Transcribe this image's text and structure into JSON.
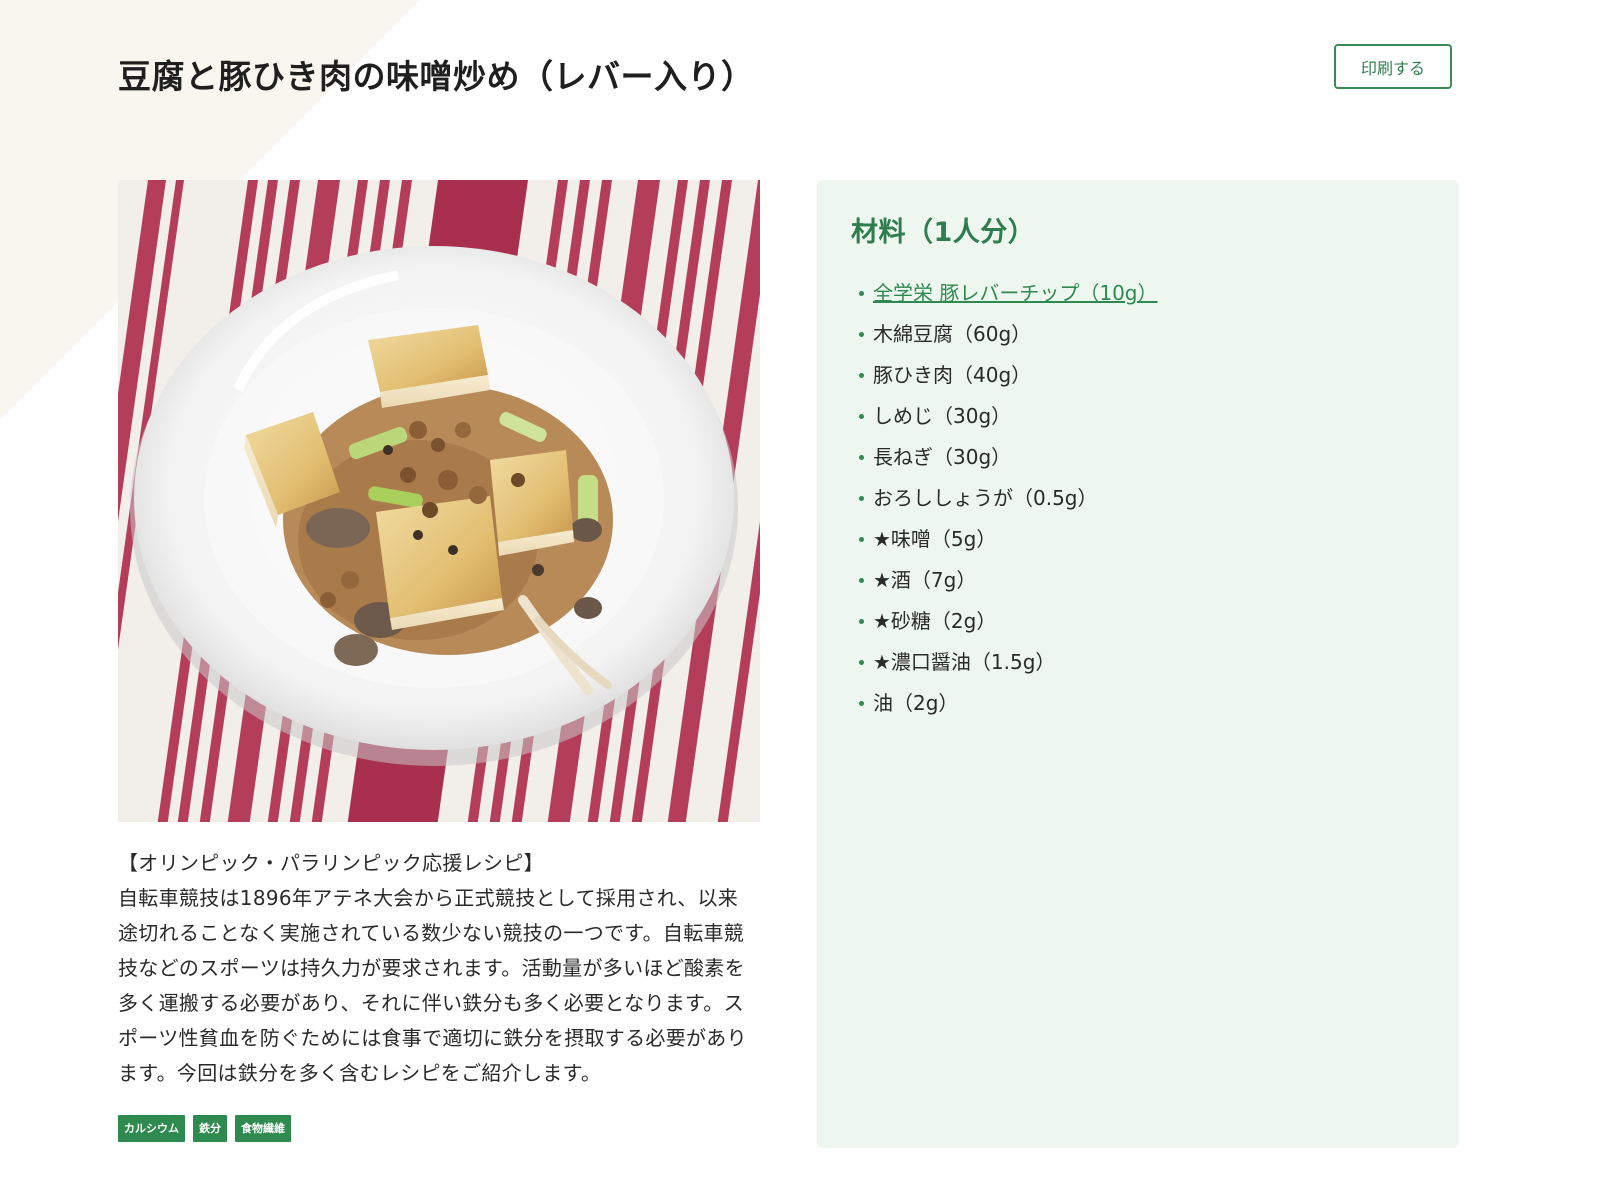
{
  "recipe": {
    "title": "豆腐と豚ひき肉の味噌炒め（レバー入り）",
    "print_label": "印刷する"
  },
  "description": {
    "heading": "【オリンピック・パラリンピック応援レシピ】",
    "body": "自転車競技は1896年アテネ大会から正式競技として採用され、以来途切れることなく実施されている数少ない競技の一つです。自転車競技などのスポーツは持久力が要求されます。活動量が多いほど酸素を多く運搬する必要があり、それに伴い鉄分も多く必要となります。スポーツ性貧血を防ぐためには食事で適切に鉄分を摂取する必要があります。今回は鉄分を多く含むレシピをご紹介します。"
  },
  "tags": [
    {
      "label": "カルシウム"
    },
    {
      "label": "鉄分"
    },
    {
      "label": "食物繊維"
    }
  ],
  "ingredients": {
    "title": "材料（1人分）",
    "items": [
      {
        "text": "全学栄 豚レバーチップ（10g）",
        "link": true
      },
      {
        "text": "木綿豆腐（60g）",
        "link": false
      },
      {
        "text": "豚ひき肉（40g）",
        "link": false
      },
      {
        "text": "しめじ（30g）",
        "link": false
      },
      {
        "text": "長ねぎ（30g）",
        "link": false
      },
      {
        "text": "おろししょうが（0.5g）",
        "link": false
      },
      {
        "text": "★味噌（5g）",
        "link": false
      },
      {
        "text": "★酒（7g）",
        "link": false
      },
      {
        "text": "★砂糖（2g）",
        "link": false
      },
      {
        "text": "★濃口醤油（1.5g）",
        "link": false
      },
      {
        "text": "油（2g）",
        "link": false
      }
    ]
  },
  "colors": {
    "accent_green": "#2f8a4f",
    "panel_bg": "#eef6f0",
    "corner_bg": "#f8f6ee",
    "tablecloth_red": "#a3344f"
  },
  "icons": {
    "bullet": "green-dot"
  }
}
